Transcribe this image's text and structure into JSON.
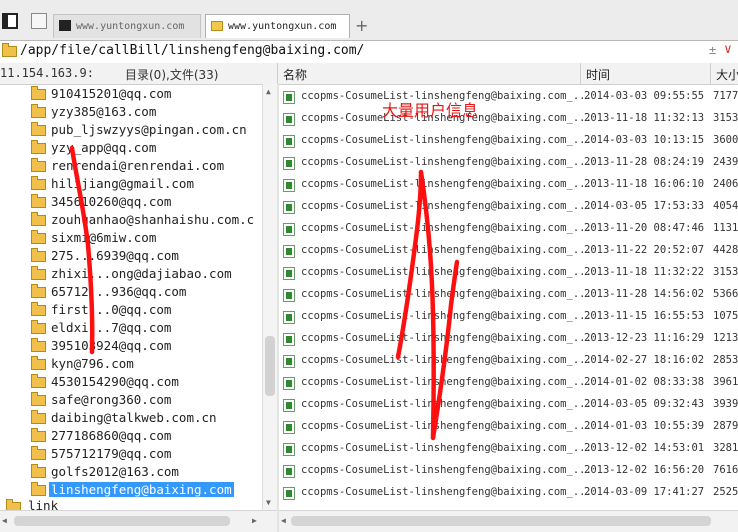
{
  "tabs": [
    {
      "title": "www.yuntongxun.com"
    },
    {
      "title": "www.yuntongxun.com"
    }
  ],
  "new_tab_symbol": "+",
  "path": "/app/file/callBill/linshengfeng@baixing.com/",
  "path_actions": {
    "minus": "±",
    "dropdown": "∨"
  },
  "header": {
    "ip": "11.154.163.9:",
    "dir_summary": "目录(0),文件(33)",
    "col_name": "名称",
    "col_time": "时间",
    "col_size": "大小"
  },
  "tree": {
    "items": [
      "910415201@qq.com",
      "yzy385@163.com",
      "pub_ljswzyys@pingan.com.cn",
      "yzy_app@qq.com",
      "renrendai@renrendai.com",
      "hilijiang@gmail.com",
      "345610260@qq.com",
      "zouhuanhao@shanhaishu.com.c",
      "sixmi@6miw.com",
      "275...6939@qq.com",
      "zhixi...ong@dajiabao.com",
      "65712...936@qq.com",
      "first...0@qq.com",
      "eldxi...7@qq.com",
      "395103924@qq.com",
      "kyn@796.com",
      "4530154290@qq.com",
      "safe@rong360.com",
      "daibing@talkweb.com.cn",
      "277186860@qq.com",
      "575712179@qq.com",
      "golfs2012@163.com",
      "linshengfeng@baixing.com"
    ],
    "selected_index": 22,
    "tail_item": "link"
  },
  "files": [
    {
      "name": "ccopms-CosumeList-linshengfeng@baixing.com_...",
      "time": "2014-03-03 09:55:55",
      "size": "7177"
    },
    {
      "name": "ccopms-CosumeList-linshengfeng@baixing.com_...",
      "time": "2013-11-18 11:32:13",
      "size": "3153"
    },
    {
      "name": "ccopms-CosumeList-linshengfeng@baixing.com_...",
      "time": "2014-03-03 10:13:15",
      "size": "3600"
    },
    {
      "name": "ccopms-CosumeList-linshengfeng@baixing.com_...",
      "time": "2013-11-28 08:24:19",
      "size": "2439"
    },
    {
      "name": "ccopms-CosumeList-linshengfeng@baixing.com_...",
      "time": "2013-11-18 16:06:10",
      "size": "2406"
    },
    {
      "name": "ccopms-CosumeList-linshengfeng@baixing.com_...",
      "time": "2014-03-05 17:53:33",
      "size": "4054"
    },
    {
      "name": "ccopms-CosumeList-linshengfeng@baixing.com_...",
      "time": "2013-11-20 08:47:46",
      "size": "1131"
    },
    {
      "name": "ccopms-CosumeList-linshengfeng@baixing.com_...",
      "time": "2013-11-22 20:52:07",
      "size": "4428"
    },
    {
      "name": "ccopms-CosumeList-linshengfeng@baixing.com_...",
      "time": "2013-11-18 11:32:22",
      "size": "3153"
    },
    {
      "name": "ccopms-CosumeList-linshengfeng@baixing.com_...",
      "time": "2013-11-28 14:56:02",
      "size": "5366"
    },
    {
      "name": "ccopms-CosumeList-linshengfeng@baixing.com_...",
      "time": "2013-11-15 16:55:53",
      "size": "1075"
    },
    {
      "name": "ccopms-CosumeList-linshengfeng@baixing.com_...",
      "time": "2013-12-23 11:16:29",
      "size": "1213"
    },
    {
      "name": "ccopms-CosumeList-linshengfeng@baixing.com_...",
      "time": "2014-02-27 18:16:02",
      "size": "2853"
    },
    {
      "name": "ccopms-CosumeList-linshengfeng@baixing.com_...",
      "time": "2014-01-02 08:33:38",
      "size": "3961"
    },
    {
      "name": "ccopms-CosumeList-linshengfeng@baixing.com_...",
      "time": "2014-03-05 09:32:43",
      "size": "3939"
    },
    {
      "name": "ccopms-CosumeList-linshengfeng@baixing.com_...",
      "time": "2014-01-03 10:55:39",
      "size": "2879"
    },
    {
      "name": "ccopms-CosumeList-linshengfeng@baixing.com_...",
      "time": "2013-12-02 14:53:01",
      "size": "3281"
    },
    {
      "name": "ccopms-CosumeList-linshengfeng@baixing.com_...",
      "time": "2013-12-02 16:56:20",
      "size": "7616"
    },
    {
      "name": "ccopms-CosumeList-linshengfeng@baixing.com_...",
      "time": "2014-03-09 17:41:27",
      "size": "2525"
    }
  ],
  "annotation": {
    "text": "大量用户信息",
    "color": "#e81616"
  },
  "colors": {
    "selection": "#3399ff",
    "folder": "#f0c04a",
    "annotation": "#e81616"
  }
}
